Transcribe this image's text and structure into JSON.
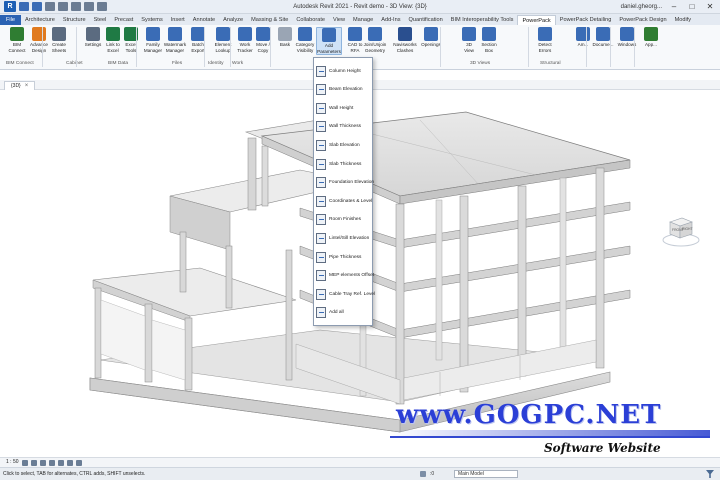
{
  "window": {
    "title": "Autodesk Revit 2021 - Revit demo - 3D View: {3D}",
    "user": "daniel.gheorg...",
    "controls": [
      "–",
      "□",
      "✕"
    ]
  },
  "ribbon_tabs": [
    "File",
    "Architecture",
    "Structure",
    "Steel",
    "Precast",
    "Systems",
    "Insert",
    "Annotate",
    "Analyze",
    "Massing & Site",
    "Collaborate",
    "View",
    "Manage",
    "Add-Ins",
    "Quantification",
    "BIM Interoperability Tools",
    "PowerPack",
    "PowerPack Detailing",
    "PowerPack Design",
    "Modify"
  ],
  "active_tab_index": 16,
  "ribbon_buttons": [
    {
      "label": "BIM\nConnect",
      "icon": "bim-connect-icon",
      "color": "#2f7d32"
    },
    {
      "label": "Advance\nDesign",
      "icon": "advance-design-icon",
      "color": "#e07a1f"
    },
    {
      "label": "Create\nSheets",
      "icon": "create-sheets-icon",
      "color": "#5b6b80"
    },
    {
      "label": "Settings",
      "icon": "gear-icon",
      "color": "#5b6b80"
    },
    {
      "label": "Link to\nExcel",
      "icon": "excel-link-icon",
      "color": "#1f7a44"
    },
    {
      "label": "Excel\nTools",
      "icon": "excel-tools-icon",
      "color": "#1f7a44"
    },
    {
      "label": "Family\nManager",
      "icon": "family-manager-icon",
      "color": "#3a6cb6"
    },
    {
      "label": "Watermark\nManager",
      "icon": "watermark-icon",
      "color": "#3a6cb6"
    },
    {
      "label": "Batch\nExport",
      "icon": "batch-export-icon",
      "color": "#3a6cb6"
    },
    {
      "label": "Element\nLookup",
      "icon": "element-lookup-icon",
      "color": "#3a6cb6"
    },
    {
      "label": "Work\nTracker",
      "icon": "work-tracker-icon",
      "color": "#3a6cb6"
    },
    {
      "label": "Move /\nCopy",
      "icon": "move-copy-icon",
      "color": "#3a6cb6"
    },
    {
      "label": "Bask",
      "icon": "bask-icon",
      "color": "#9aa5b4"
    },
    {
      "label": "Category\nVisibility",
      "icon": "category-visibility-icon",
      "color": "#3a6cb6"
    },
    {
      "label": "Add\nParameters",
      "icon": "add-parameters-icon",
      "color": "#3a6cb6"
    },
    {
      "label": "CAD to\nRFA",
      "icon": "cad-to-rfa-icon",
      "color": "#3a6cb6"
    },
    {
      "label": "Join/Unjoin\nGeometry",
      "icon": "join-geometry-icon",
      "color": "#3a6cb6"
    },
    {
      "label": "Navisworks\nClashes",
      "icon": "navisworks-icon",
      "color": "#2a4f8f"
    },
    {
      "label": "Openings",
      "icon": "openings-icon",
      "color": "#3a6cb6"
    },
    {
      "label": "3D\nView",
      "icon": "3d-view-icon",
      "color": "#3a6cb6"
    },
    {
      "label": "Section\nBox",
      "icon": "section-box-icon",
      "color": "#3a6cb6"
    },
    {
      "label": "Detect\nErrors",
      "icon": "detect-errors-icon",
      "color": "#3a6cb6"
    },
    {
      "label": "Am...",
      "icon": "am-icon",
      "color": "#3a6cb6"
    },
    {
      "label": "Docume...",
      "icon": "document-icon",
      "color": "#3a6cb6"
    },
    {
      "label": "Windows",
      "icon": "windows-icon",
      "color": "#3a6cb6"
    },
    {
      "label": "App...",
      "icon": "app-icon",
      "color": "#2f7d32"
    }
  ],
  "ribbon_groups": [
    "BIM Connect",
    "Cabinet",
    "BIM Data",
    "Files",
    "Identity",
    "Work",
    "3D Views",
    "Structural"
  ],
  "view_tab": {
    "label": "{3D}",
    "close": "×"
  },
  "viewcube": {
    "front": "FRONT",
    "right": "RIGHT"
  },
  "dropdown_items": [
    {
      "label": "Column Height"
    },
    {
      "label": "Beam Elevation"
    },
    {
      "label": "Wall Height"
    },
    {
      "label": "Wall Thickness"
    },
    {
      "label": "Slab Elevation"
    },
    {
      "label": "Slab Thickness"
    },
    {
      "label": "Foundation Elevation"
    },
    {
      "label": "Coordinates & Level"
    },
    {
      "label": "Room Finishes"
    },
    {
      "label": "Lintel/Sill Elevation"
    },
    {
      "label": "Pipe Thickness"
    },
    {
      "label": "MEP elements Offset"
    },
    {
      "label": "Cable Tray Ref. Level"
    },
    {
      "label": "Add all"
    }
  ],
  "watermark": {
    "title": "www.GOGPC.NET",
    "subtitle": "Software Website"
  },
  "view_control": {
    "scale": "1 : 50"
  },
  "status": {
    "text": "Click to select, TAB for alternates, CTRL adds, SHIFT unselects.",
    "model": "Main Model",
    "zero": ":0"
  }
}
